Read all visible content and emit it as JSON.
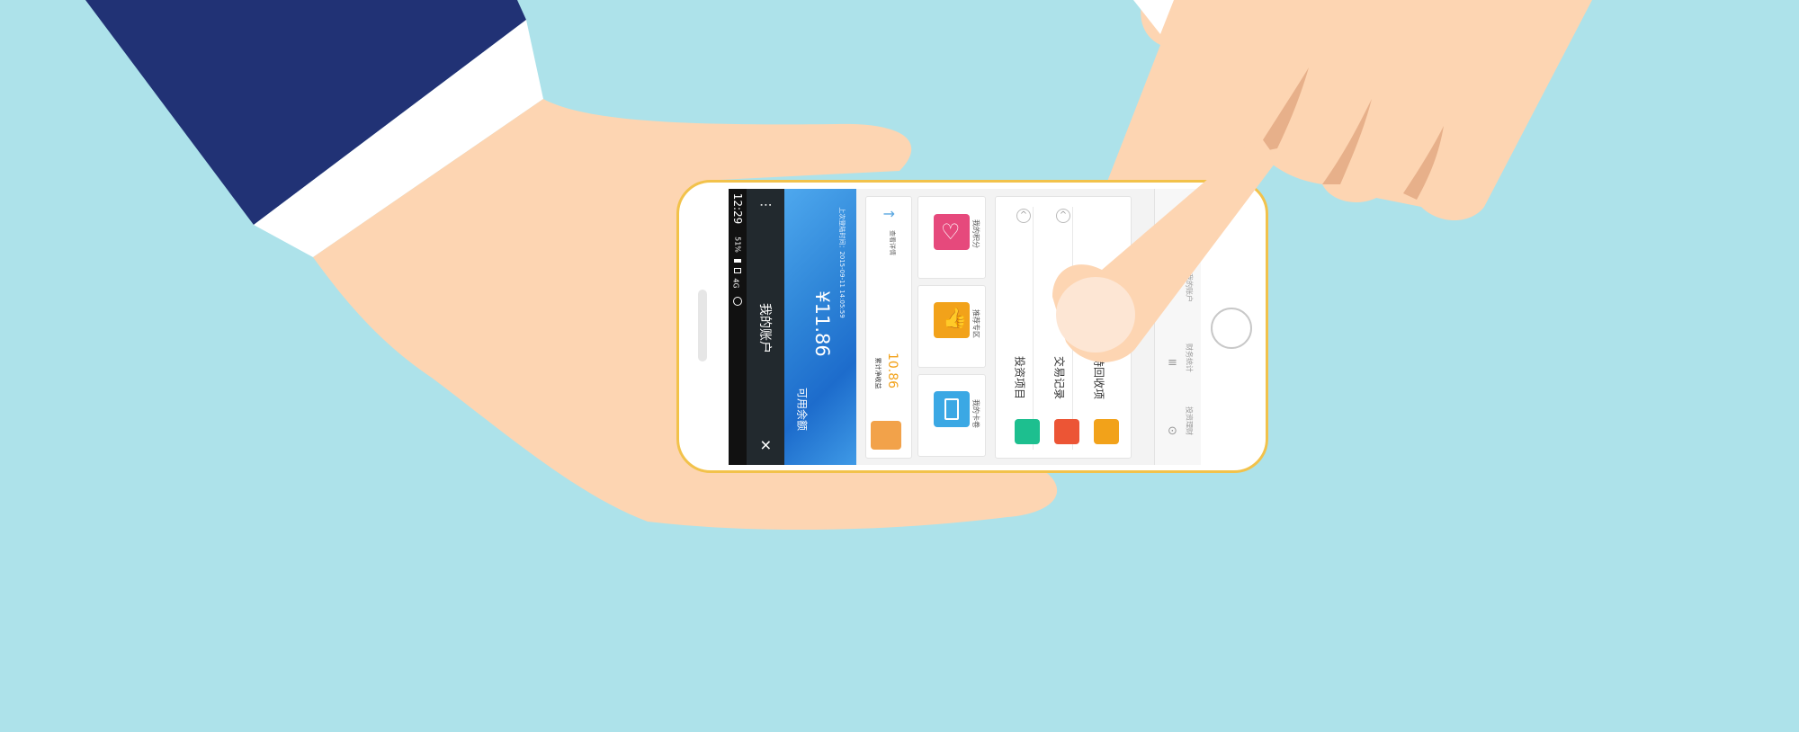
{
  "status_bar": {
    "time": "12:29",
    "network": "4G",
    "battery": "51%"
  },
  "header": {
    "title": "我的账户",
    "menu_icon": "more-dots-icon",
    "close_icon": "close-icon"
  },
  "balance": {
    "label": "可用余额",
    "amount": "¥11.86",
    "last_time": "上次登陆时间：2015-09-11 14:05:59"
  },
  "income": {
    "label": "累计净收益",
    "value": "10.86",
    "detail_label": "查看详情"
  },
  "features": [
    {
      "label": "我的积分",
      "icon": "heart-icon",
      "color": "#e6497c"
    },
    {
      "label": "推荐专区",
      "icon": "thumbs-up-icon",
      "color": "#f2a21a"
    },
    {
      "label": "我的卡卷",
      "icon": "card-icon",
      "color": "#3ba8e4"
    }
  ],
  "menu": [
    {
      "label": "投资项目",
      "icon": "clock-icon",
      "color": "#1dbf8f"
    },
    {
      "label": "交易记录",
      "icon": "target-icon",
      "color": "#ec5535"
    },
    {
      "label": "待回收项",
      "icon": "refresh-icon",
      "color": "#f2a21a"
    }
  ],
  "tabs": [
    {
      "label": "投资理财",
      "icon": "coin-icon"
    },
    {
      "label": "财务统计",
      "icon": "stack-icon"
    },
    {
      "label": "我的账户",
      "icon": "user-icon"
    }
  ],
  "colors": {
    "background": "#ade2ea",
    "skin": "#fdd5b2",
    "sleeve": "#213275",
    "phone_frame": "#f2c24b",
    "accent_blue": "#2f86d8",
    "accent_orange": "#f2a21a"
  }
}
